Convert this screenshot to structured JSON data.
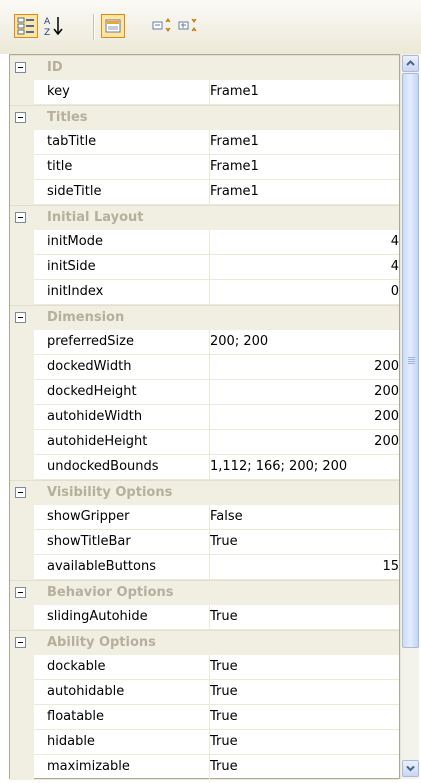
{
  "toolbar": {
    "buttons": [
      {
        "name": "categorized-icon",
        "checked": true
      },
      {
        "name": "alphabetical-icon",
        "checked": false
      },
      {
        "name": "properties-icon",
        "checked": true
      },
      {
        "name": "expand-all-icon",
        "checked": false
      },
      {
        "name": "collapse-all-icon",
        "checked": false
      }
    ]
  },
  "categories": [
    {
      "label": "ID",
      "properties": [
        {
          "name": "key",
          "value": "Frame1",
          "align": "left"
        }
      ]
    },
    {
      "label": "Titles",
      "properties": [
        {
          "name": "tabTitle",
          "value": "Frame1",
          "align": "left"
        },
        {
          "name": "title",
          "value": "Frame1",
          "align": "left"
        },
        {
          "name": "sideTitle",
          "value": "Frame1",
          "align": "left"
        }
      ]
    },
    {
      "label": "Initial Layout",
      "properties": [
        {
          "name": "initMode",
          "value": "4",
          "align": "right"
        },
        {
          "name": "initSide",
          "value": "4",
          "align": "right"
        },
        {
          "name": "initIndex",
          "value": "0",
          "align": "right"
        }
      ]
    },
    {
      "label": "Dimension",
      "properties": [
        {
          "name": "preferredSize",
          "value": "200; 200",
          "align": "left"
        },
        {
          "name": "dockedWidth",
          "value": "200",
          "align": "right"
        },
        {
          "name": "dockedHeight",
          "value": "200",
          "align": "right"
        },
        {
          "name": "autohideWidth",
          "value": "200",
          "align": "right"
        },
        {
          "name": "autohideHeight",
          "value": "200",
          "align": "right"
        },
        {
          "name": "undockedBounds",
          "value": "1,112; 166; 200; 200",
          "align": "left"
        }
      ]
    },
    {
      "label": "Visibility Options",
      "properties": [
        {
          "name": "showGripper",
          "value": "False",
          "align": "left"
        },
        {
          "name": "showTitleBar",
          "value": "True",
          "align": "left"
        },
        {
          "name": "availableButtons",
          "value": "15",
          "align": "right"
        }
      ]
    },
    {
      "label": "Behavior Options",
      "properties": [
        {
          "name": "slidingAutohide",
          "value": "True",
          "align": "left"
        }
      ]
    },
    {
      "label": "Ability Options",
      "properties": [
        {
          "name": "dockable",
          "value": "True",
          "align": "left"
        },
        {
          "name": "autohidable",
          "value": "True",
          "align": "left"
        },
        {
          "name": "floatable",
          "value": "True",
          "align": "left"
        },
        {
          "name": "hidable",
          "value": "True",
          "align": "left"
        },
        {
          "name": "maximizable",
          "value": "True",
          "align": "left"
        }
      ]
    }
  ],
  "colors": {
    "category_text": "#b5b09c",
    "category_bg": "#f1efe2",
    "grid_line": "#ece9d8"
  }
}
